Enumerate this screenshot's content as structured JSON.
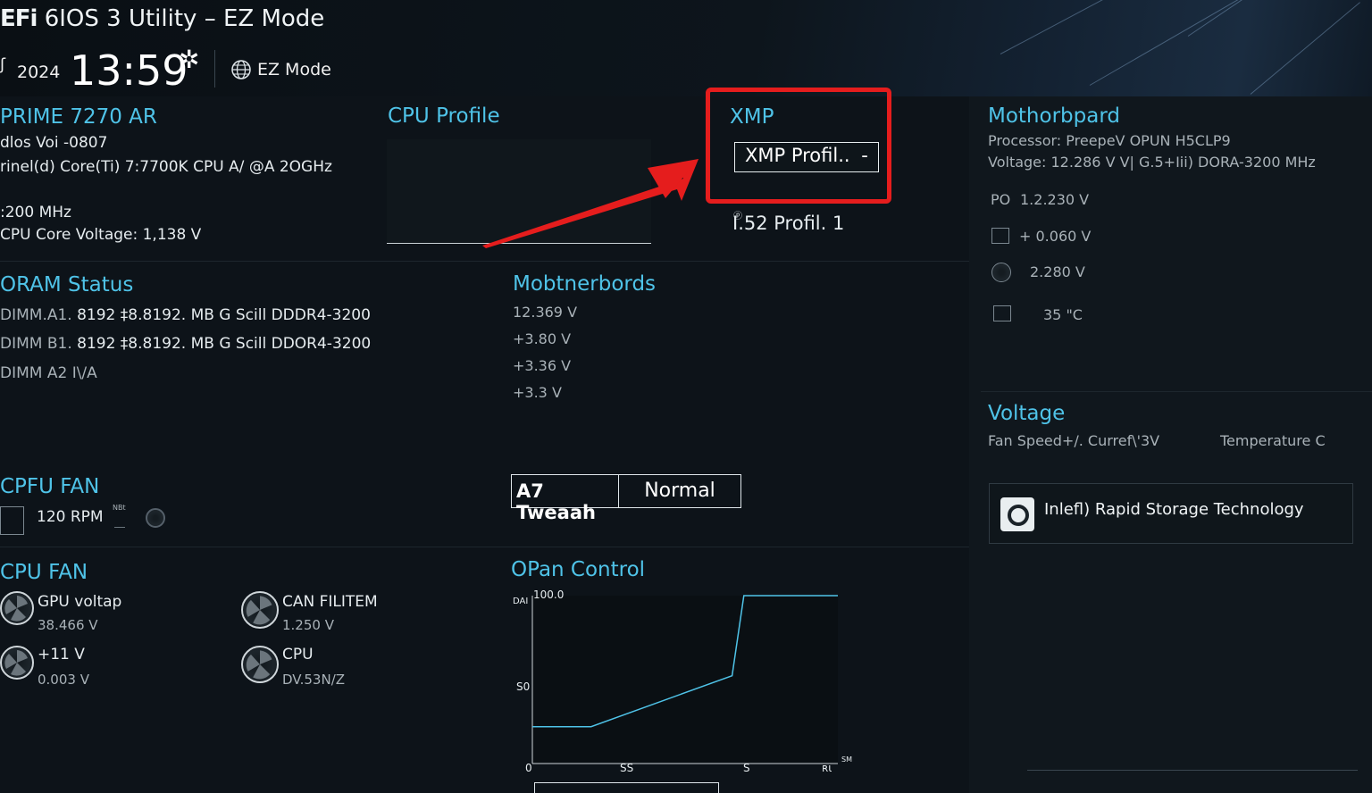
{
  "header": {
    "title_logo": "EFi",
    "title_rest": " 6IOS 3 Utility – EZ Mode",
    "wave_glyph": "ʃ",
    "year": "2024",
    "time": "13:59",
    "gear_glyph": "✲",
    "mode": "EZ Mode"
  },
  "info": {
    "model": "PRIME 7270 AR",
    "bios": "dlos Voi -0807",
    "cpu": "rinel(d) Core(Ti) 7:7700K CPU A/ @A 2OGHz",
    "freq": ":200 MHz",
    "core_voltage": "CPU Core Voltage: 1,138 V"
  },
  "cpu_profile": {
    "title": "CPU Profile"
  },
  "xmp": {
    "title": "XMP",
    "select_value": "XMP Profil..",
    "select_suffix": "-",
    "sub_icon": "ⓟ",
    "sub_label": "I.52 Profil. 1"
  },
  "dram": {
    "title": "ORAM Status",
    "slots": [
      {
        "name": "DIMM.A1.",
        "value": "8192 ‡8.8192. MB G Scill DDDR4-3200"
      },
      {
        "name": "DIMM B1.",
        "value": "8192 ‡8.8192. MB G Scill DDOR4-3200"
      },
      {
        "name": "DIMM  A2 I\\/A",
        "value": ""
      }
    ]
  },
  "mobo_voltages": {
    "title": "Mobtnerbords",
    "items": [
      "12.369 V",
      "+3.80 V",
      "+3.36 V",
      "+3.3 V"
    ]
  },
  "cpu_fan_top": {
    "title": "CPFU FAN",
    "rpm": "120 RPM",
    "small_label": "NBt"
  },
  "tweaker": {
    "label": "A7 Tweaah",
    "value": "Normal"
  },
  "cpu_fan_bottom": {
    "title": "CPU FAN",
    "fans": [
      {
        "name": "GPU voltap",
        "value": "38.466 V"
      },
      {
        "name": "CAN FILITEM",
        "value": "1.250 V"
      },
      {
        "name": "+11 V",
        "value": "0.003 V"
      },
      {
        "name": "CPU",
        "value": "DV.53N/Z"
      }
    ]
  },
  "fan_control": {
    "title": "OPan Control",
    "chart_data": {
      "type": "line",
      "x_ticks": [
        "0",
        "SS",
        "S",
        "ʀι"
      ],
      "y_ticks": [
        "100.0",
        "S0"
      ],
      "y_axis_label": "DAI",
      "x_end_label": "SM",
      "series": [
        {
          "points": [
            [
              0,
              10
            ],
            [
              25,
              10
            ],
            [
              85,
              45
            ],
            [
              90,
              100
            ],
            [
              130,
              100
            ]
          ]
        }
      ],
      "color": "#4fc3e8"
    }
  },
  "motherboard": {
    "title": "Mothorbpard",
    "processor": "Processor: PreepeV  OPUN H5CLP9",
    "voltage": "Voltage: 12.286 V V| G.5+Iii)  DORA-3200 MHz",
    "readings": [
      {
        "icon": "PO",
        "value": "1.2.230 V"
      },
      {
        "icon": "plug-icon",
        "value": "+ 0.060 V"
      },
      {
        "icon": "fan-icon",
        "value": "2.280 V"
      },
      {
        "icon": "chip-icon",
        "value": "35 \"C"
      }
    ]
  },
  "voltage_panel": {
    "title": "Voltage",
    "col1": "Fan Speed+/. Curref\\'3V",
    "col2": "Temperature C"
  },
  "rst": {
    "label": "Inlefl) Rapid Storage Technology"
  },
  "colors": {
    "accent": "#4fc3e8",
    "highlight_frame": "#e51d1d",
    "background": "#0d1319"
  }
}
